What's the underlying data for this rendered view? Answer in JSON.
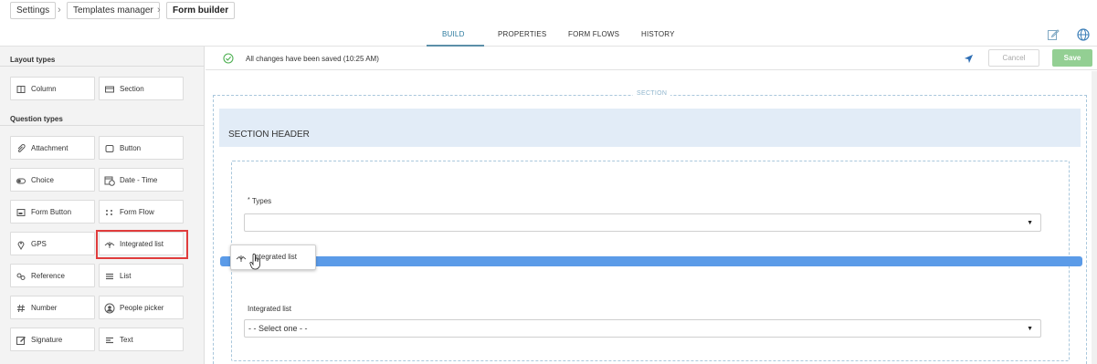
{
  "breadcrumb": {
    "items": [
      "Settings",
      "Templates manager",
      "Form builder"
    ]
  },
  "tabs": [
    "BUILD",
    "PROPERTIES",
    "FORM FLOWS",
    "HISTORY"
  ],
  "active_tab": "BUILD",
  "sidebar": {
    "layout_heading": "Layout types",
    "layout_items": [
      {
        "label": "Column",
        "icon": "column-icon"
      },
      {
        "label": "Section",
        "icon": "section-icon"
      }
    ],
    "question_heading": "Question types",
    "question_items": [
      {
        "label": "Attachment",
        "icon": "paperclip-icon"
      },
      {
        "label": "Button",
        "icon": "button-icon"
      },
      {
        "label": "Choice",
        "icon": "toggle-icon"
      },
      {
        "label": "Date - Time",
        "icon": "calendar-clock-icon"
      },
      {
        "label": "Form Button",
        "icon": "form-button-icon"
      },
      {
        "label": "Form Flow",
        "icon": "form-flow-icon"
      },
      {
        "label": "GPS",
        "icon": "location-pin-icon"
      },
      {
        "label": "Integrated list",
        "icon": "integrated-list-icon"
      },
      {
        "label": "Reference",
        "icon": "link-icon"
      },
      {
        "label": "List",
        "icon": "list-icon"
      },
      {
        "label": "Number",
        "icon": "hash-icon"
      },
      {
        "label": "People picker",
        "icon": "person-icon"
      },
      {
        "label": "Signature",
        "icon": "pen-icon"
      },
      {
        "label": "Text",
        "icon": "text-lines-icon"
      }
    ]
  },
  "toolbar": {
    "status": "All changes have been saved (10:25 AM)",
    "cancel_label": "Cancel",
    "save_label": "Save"
  },
  "canvas": {
    "section_label": "SECTION",
    "section_header": "SECTION HEADER",
    "fields": [
      {
        "label": "Types",
        "required": "*",
        "value": ""
      },
      {
        "label": "Integrated list",
        "value": "- - Select one - -"
      }
    ],
    "drag_chip_label": "Integrated list"
  },
  "colors": {
    "accent_blue": "#5b9be8",
    "save_green": "#93cf93",
    "highlight_red": "#e03c3c",
    "section_header_bg": "#e2ecf7"
  }
}
